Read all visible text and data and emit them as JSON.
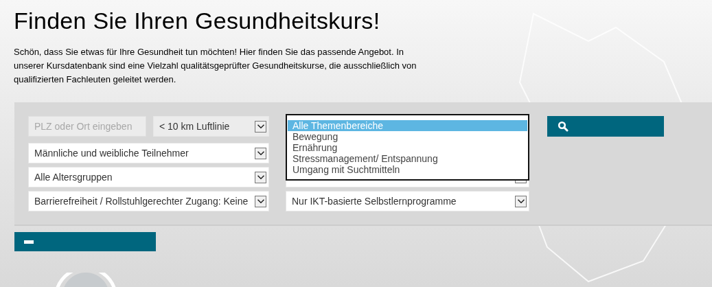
{
  "title": "Finden Sie Ihren Gesundheitskurs!",
  "intro": "Schön, dass Sie etwas für Ihre Gesundheit tun möchten! Hier finden Sie das passende Angebot. In unserer Kursdatenbank sind eine Vielzahl qualitätsgeprüfter Gesundheitskurse, die ausschließlich von qualifizierten Fachleuten geleitet werden.",
  "search_form": {
    "location": {
      "placeholder": "PLZ oder Ort eingeben",
      "disabled": true
    },
    "radius": {
      "value": "< 10 km Luftlinie",
      "disabled": true
    },
    "filters_left": [
      {
        "value": "Männliche und weibliche Teilnehmer"
      },
      {
        "value": "Alle Altersgruppen"
      },
      {
        "value": "Barrierefreiheit / Rollstuhlgerechter Zugang: Keine"
      }
    ],
    "filters_right": [
      {
        "value": "Nur IKT-basierte Selbstlernprogramme"
      }
    ],
    "topic_list": {
      "options": [
        {
          "label": "Alle Themenbereiche",
          "selected": true
        },
        {
          "label": "Bewegung",
          "selected": false
        },
        {
          "label": "Ernährung",
          "selected": false
        },
        {
          "label": "Stressmanagement/ Entspannung",
          "selected": false
        },
        {
          "label": "Umgang mit Suchtmitteln",
          "selected": false
        }
      ]
    },
    "collapsed": false
  }
}
